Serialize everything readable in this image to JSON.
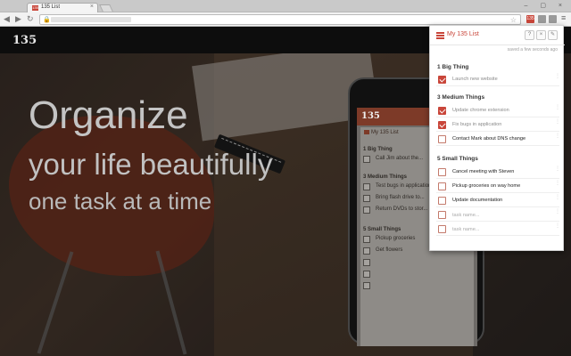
{
  "browser": {
    "tab_title": "135 List",
    "tab_favicon": "135",
    "tab_close": "×",
    "window_controls": "– ▢ ×",
    "back": "◀",
    "forward": "▶",
    "reload": "↻",
    "ext_label": "135",
    "menu": "≡",
    "star": "☆",
    "lock": "🔒"
  },
  "site": {
    "logo": "135",
    "hero": [
      "Organize",
      "your life beautifully",
      "one task at a time"
    ]
  },
  "phone": {
    "logo": "135",
    "list_title": "My 135 List",
    "sections": [
      {
        "title": "1 Big Thing",
        "items": [
          "Call Jim about the..."
        ]
      },
      {
        "title": "3 Medium Things",
        "items": [
          "Test bugs in application",
          "Bring flash drive to...",
          "Return DVDs to stor..."
        ]
      },
      {
        "title": "5 Small Things",
        "items": [
          "Pickup groceries",
          "Get flowers",
          "",
          "",
          ""
        ]
      }
    ]
  },
  "popup": {
    "title": "My 135 List",
    "saved_text": "saved a few seconds ago",
    "buttons": {
      "help": "?",
      "close": "×",
      "edit": "✎"
    },
    "sections": [
      {
        "title": "1 Big Thing",
        "tasks": [
          {
            "text": "Launch new website",
            "checked": true
          }
        ]
      },
      {
        "title": "3 Medium Things",
        "tasks": [
          {
            "text": "Update chrome extension",
            "checked": true
          },
          {
            "text": "Fix bugs in application",
            "checked": true
          },
          {
            "text": "Contact Mark about DNS change",
            "checked": false
          }
        ]
      },
      {
        "title": "5 Small Things",
        "tasks": [
          {
            "text": "Cancel meeting with Steven",
            "checked": false
          },
          {
            "text": "Pickup groceries on way home",
            "checked": false
          },
          {
            "text": "Update documentation",
            "checked": false
          },
          {
            "text": "",
            "placeholder": "task name...",
            "checked": false
          },
          {
            "text": "",
            "placeholder": "task name...",
            "checked": false
          }
        ]
      }
    ]
  },
  "colors": {
    "accent": "#c9463a",
    "header": "#0d0d0d"
  }
}
